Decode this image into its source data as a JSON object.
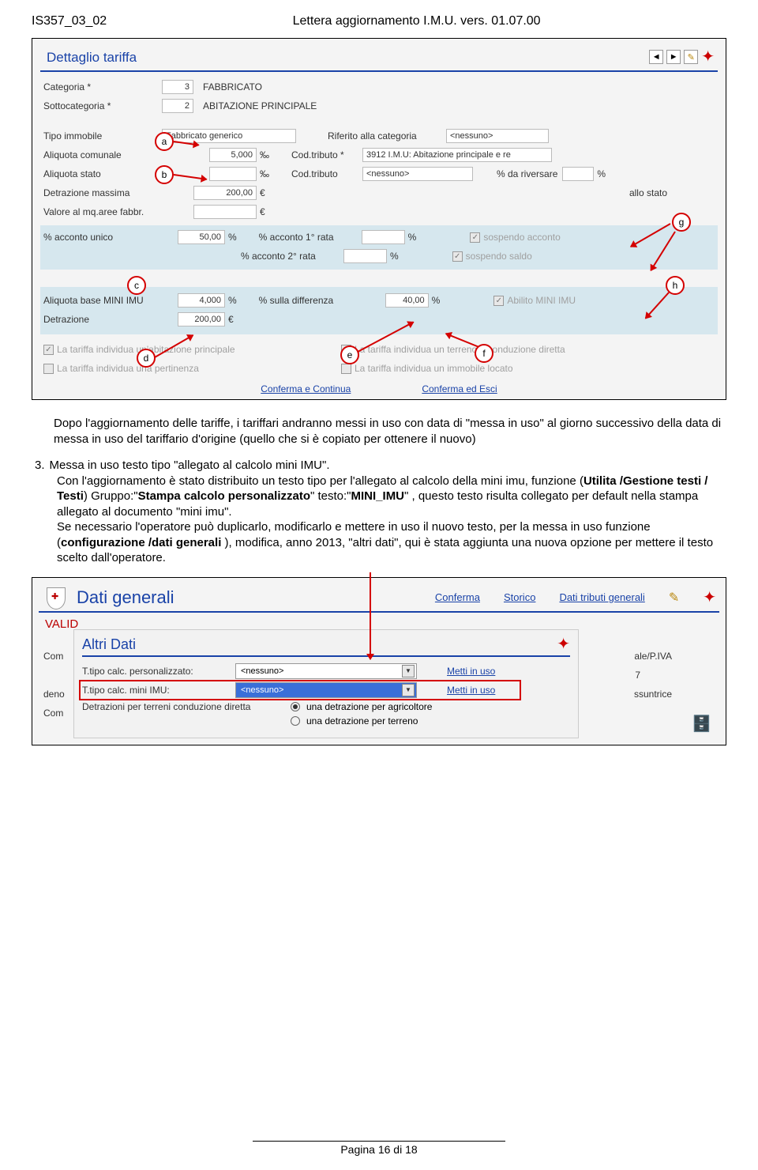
{
  "header": {
    "left": "IS357_03_02",
    "center": "Lettera aggiornamento  I.M.U.  vers.  01.07.00"
  },
  "s1": {
    "title": "Dettaglio tariffa",
    "categoria_l": "Categoria  *",
    "categoria_num": "3",
    "categoria_txt": "FABBRICATO",
    "sotto_l": "Sottocategoria  *",
    "sotto_num": "2",
    "sotto_txt": "ABITAZIONE PRINCIPALE",
    "tipoimm_l": "Tipo immobile",
    "tipoimm_v": "Fabbricato generico",
    "rifcat_l": "Riferito alla categoria",
    "rifcat_v": "<nessuno>",
    "aliqcom_l": "Aliquota comunale",
    "aliqcom_v": "5,000",
    "permille": "‰",
    "codtrib_l": "Cod.tributo  *",
    "codtrib_v": "3912 I.M.U: Abitazione principale e re",
    "aliqsta_l": "Aliquota stato",
    "aliqsta_v": "",
    "codtrib2_l": "Cod.tributo",
    "codtrib2_v": "<nessuno>",
    "pct_riv_l": "% da riversare",
    "pct_riv_u": "%",
    "detrmax_l": "Detrazione massima",
    "detrmax_v": "200,00",
    "eur": "€",
    "allo_stato": "allo stato",
    "valmq_l": "Valore al mq.aree fabbr.",
    "valmq_v": "",
    "acconto_unico_l": "% acconto unico",
    "acconto_unico_v": "50,00",
    "pct": "%",
    "acc1_l": "% acconto 1° rata",
    "acc1_v": "",
    "acc2_l": "% acconto 2° rata",
    "acc2_v": "",
    "sosp_acc": "sospendo acconto",
    "sosp_saldo": "sospendo saldo",
    "aliq_mini_l": "Aliquota base MINI IMU",
    "aliq_mini_v": "4,000",
    "pct_diff_l": "% sulla differenza",
    "pct_diff_v": "40,00",
    "abil_mini": "Abilito MINI IMU",
    "detr_l": "Detrazione",
    "detr_v": "200,00",
    "tf_abit": "La tariffa individua un'abitazione principale",
    "tf_terr": "La tariffa individua un terreno a conduzione diretta",
    "tf_pert": "La tariffa individua una pertinenza",
    "tf_loc": "La tariffa individua un immobile locato",
    "conf_cont": "Conferma e Continua",
    "conf_esci": "Conferma ed Esci"
  },
  "callouts": {
    "a": "a",
    "b": "b",
    "c": "c",
    "d": "d",
    "e": "e",
    "f": "f",
    "g": "g",
    "h": "h"
  },
  "para1": "Dopo l'aggiornamento delle tariffe, i tariffari andranno messi in uso con data di \"messa in uso\" al giorno successivo della data di messa in uso del tariffario d'origine (quello che si è copiato per ottenere il nuovo)",
  "para2_num": "3.",
  "para2_title": "Messa in uso testo tipo \"allegato al calcolo mini IMU\".",
  "para2_a": "Con l'aggiornamento è stato distribuito un testo tipo per l'allegato al calcolo della mini imu, funzione (",
  "para2_b1": "Utilita /Gestione testi / Testi",
  "para2_b2": ") Gruppo:\"",
  "para2_b3": "Stampa calcolo personalizzato",
  "para2_b4": "\" testo:\"",
  "para2_b5": "MINI_IMU",
  "para2_b6": "\" , questo testo risulta collegato per default nella stampa allegato al documento \"mini imu\".",
  "para2_c": "Se necessario l'operatore può duplicarlo, modificarlo e mettere in uso il nuovo testo, per la messa in uso funzione (",
  "para2_c1": "configurazione /dati generali",
  "para2_c2": " ), modifica, anno 2013, \"altri dati\", qui è stata aggiunta una nuova opzione per mettere il testo scelto dall'operatore.",
  "s2": {
    "title": "Dati generali",
    "links": {
      "conf": "Conferma",
      "storico": "Storico",
      "dtg": "Dati tributi generali"
    },
    "valid": "VALID",
    "inner_title": "Altri Dati",
    "f1_l": "T.tipo calc. personalizzato:",
    "f1_v": "<nessuno>",
    "f1_link": "Metti in uso",
    "f2_l": "T.tipo calc. mini IMU:",
    "f2_v": "<nessuno>",
    "f2_link": "Metti in uso",
    "f3_l": "Detrazioni per terreni conduzione diretta",
    "r1": "una detrazione per agricoltore",
    "r2": "una detrazione per terreno",
    "side1": "Com",
    "side2": "deno",
    "side3": "Com",
    "side_r1": "ale/P.IVA",
    "side_r2": "7",
    "side_r3": "ssuntrice"
  },
  "footer": "Pagina 16 di 18"
}
